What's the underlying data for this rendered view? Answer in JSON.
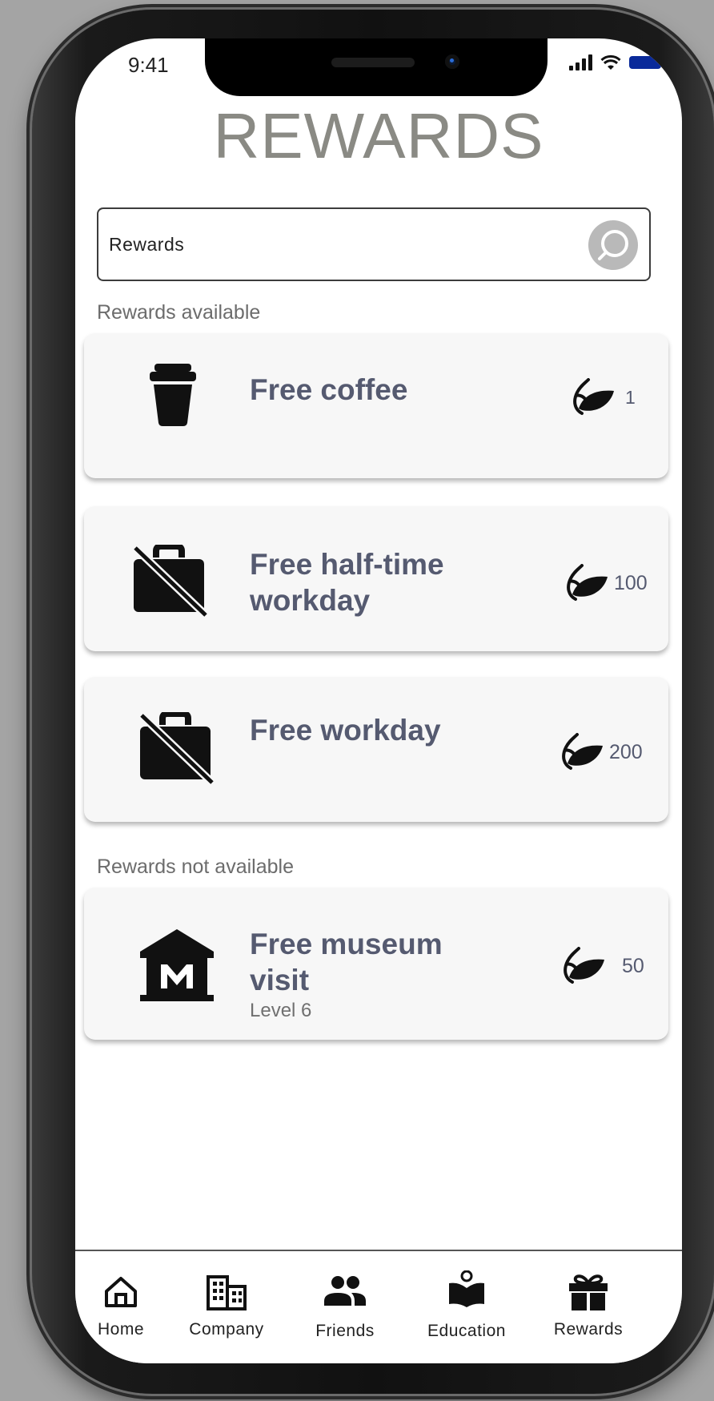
{
  "status_bar": {
    "time": "9:41"
  },
  "page": {
    "title": "REWARDS"
  },
  "search": {
    "value": "Rewards"
  },
  "sections": {
    "available_label": "Rewards available",
    "unavailable_label": "Rewards not available"
  },
  "rewards_available": [
    {
      "name": "Free coffee",
      "cost": "1",
      "icon": "coffee-cup-icon"
    },
    {
      "name": "Free half-time workday",
      "cost": "100",
      "icon": "work-off-icon"
    },
    {
      "name": "Free workday",
      "cost": "200",
      "icon": "work-off-icon"
    }
  ],
  "rewards_unavailable": [
    {
      "name": "Free museum visit",
      "requirement": "Level 6",
      "cost": "50",
      "icon": "museum-icon"
    }
  ],
  "bottom_nav": [
    {
      "label": "Home",
      "icon": "home-icon"
    },
    {
      "label": "Company",
      "icon": "building-icon"
    },
    {
      "label": "Friends",
      "icon": "people-icon"
    },
    {
      "label": "Education",
      "icon": "book-reader-icon"
    },
    {
      "label": "Rewards",
      "icon": "gift-icon"
    }
  ],
  "colors": {
    "title": "#8a8a84",
    "card_text": "#555a70",
    "card_bg": "#f7f7f7",
    "search_button": "#b9b9b9"
  }
}
